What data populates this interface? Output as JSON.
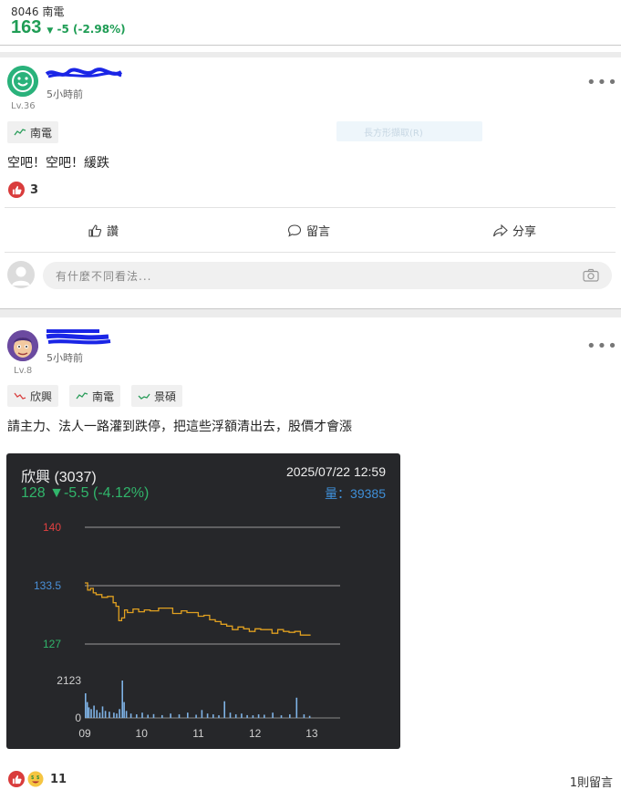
{
  "header": {
    "code": "8046",
    "name": "南電",
    "price": "163",
    "change": "-5 (-2.98%)",
    "change_arrow": "▼",
    "color_down": "#1f9d55"
  },
  "post1": {
    "time": "5小時前",
    "level": "Lv.36",
    "more": "•••",
    "tags": [
      "南電"
    ],
    "ghost_button": "長方形擷取(R)",
    "text": "空吧！空吧！緩跌",
    "reaction_count": "3",
    "actions": {
      "like": "讚",
      "comment": "留言",
      "share": "分享"
    },
    "comment_placeholder": "有什麼不同看法..."
  },
  "post2": {
    "time": "5小時前",
    "level": "Lv.8",
    "more": "•••",
    "tags": [
      "欣興",
      "南電",
      "景碩"
    ],
    "text": "請主力、法人一路灌到跌停，把這些浮額清出去，股價才會漲",
    "reaction_count": "11",
    "comments_count": "1則留言"
  },
  "chart_card": {
    "name": "欣興 (3037)",
    "datetime": "2025/07/22 12:59",
    "price_line": "128 ▼-5.5 (-4.12%)",
    "volume_label": "量：39385"
  },
  "chart_data": {
    "type": "line",
    "ylim": [
      127,
      140
    ],
    "y_ticks": [
      {
        "label": "140",
        "value": 140,
        "color": "#e04040"
      },
      {
        "label": "133.5",
        "value": 133.5,
        "color": "#4a90d9"
      },
      {
        "label": "127",
        "value": 127,
        "color": "#31b56b"
      }
    ],
    "x_ticks": [
      "09",
      "10",
      "11",
      "12",
      "13"
    ],
    "x_tick_hours": [
      9,
      10,
      11,
      12,
      13
    ],
    "xlim_hours": [
      9,
      13.5
    ],
    "price_series": {
      "name": "",
      "color": "#e0a020",
      "x_hours": [
        9.0,
        9.05,
        9.1,
        9.15,
        9.2,
        9.3,
        9.4,
        9.5,
        9.55,
        9.6,
        9.65,
        9.7,
        9.75,
        9.85,
        9.95,
        10.05,
        10.15,
        10.3,
        10.45,
        10.55,
        10.7,
        10.8,
        10.9,
        11.0,
        11.1,
        11.2,
        11.3,
        11.4,
        11.5,
        11.6,
        11.7,
        11.8,
        11.9,
        12.0,
        12.1,
        12.2,
        12.3,
        12.4,
        12.5,
        12.6,
        12.7,
        12.8,
        12.9,
        12.98
      ],
      "values": [
        133.8,
        133.0,
        133.2,
        132.7,
        132.5,
        132.2,
        132.3,
        131.6,
        131.2,
        129.6,
        129.9,
        130.8,
        130.5,
        130.9,
        130.6,
        130.8,
        130.7,
        131.0,
        131.0,
        130.4,
        130.7,
        130.5,
        130.5,
        130.1,
        130.2,
        129.7,
        129.5,
        129.2,
        129.0,
        128.6,
        128.9,
        128.7,
        128.4,
        128.7,
        128.6,
        128.6,
        128.2,
        128.6,
        128.4,
        128.3,
        128.4,
        128.0,
        128.0,
        128.0
      ],
      "close": 128
    },
    "volume_series": {
      "name": "",
      "color": "#7fb3e6",
      "max_label": "2123",
      "zero_label": "0",
      "max": 2123,
      "x_hours": [
        9.0,
        9.03,
        9.06,
        9.1,
        9.15,
        9.2,
        9.25,
        9.3,
        9.35,
        9.42,
        9.5,
        9.55,
        9.6,
        9.65,
        9.68,
        9.72,
        9.8,
        9.9,
        10.0,
        10.1,
        10.2,
        10.35,
        10.5,
        10.65,
        10.8,
        10.95,
        11.05,
        11.15,
        11.25,
        11.35,
        11.45,
        11.55,
        11.65,
        11.75,
        11.85,
        11.95,
        12.05,
        12.15,
        12.3,
        12.45,
        12.6,
        12.72,
        12.85,
        12.95
      ],
      "values": [
        1400,
        900,
        600,
        500,
        700,
        450,
        300,
        650,
        400,
        350,
        300,
        250,
        500,
        2123,
        900,
        400,
        250,
        200,
        300,
        180,
        220,
        160,
        250,
        200,
        300,
        180,
        450,
        250,
        200,
        150,
        950,
        300,
        200,
        250,
        160,
        150,
        200,
        180,
        300,
        150,
        200,
        1150,
        200,
        120
      ]
    }
  }
}
